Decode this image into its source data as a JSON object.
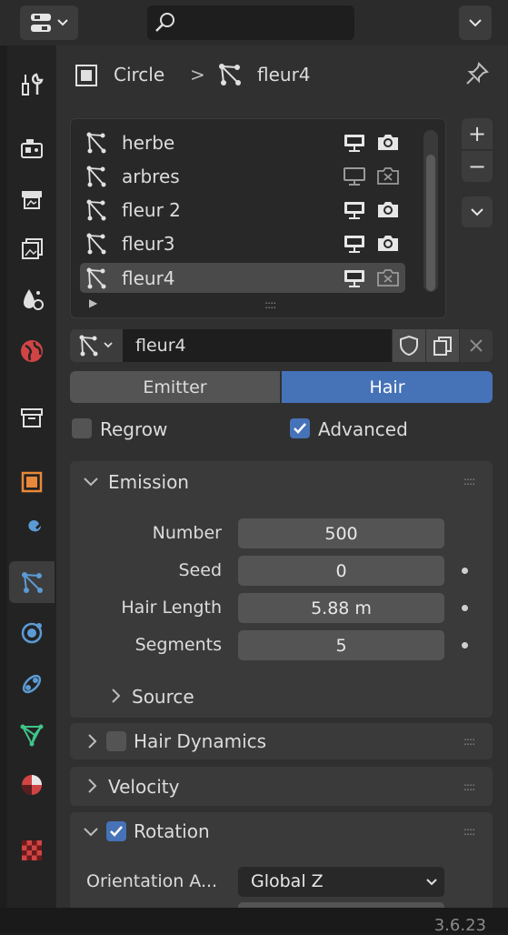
{
  "header": {
    "editor_type_icon": "properties-editor-icon",
    "search_icon": "search-icon",
    "menu_icon": "chevron-down-icon"
  },
  "tabs": [
    {
      "icon": "tool-icon"
    },
    {
      "icon": "render-icon"
    },
    {
      "icon": "output-icon"
    },
    {
      "icon": "view-layer-icon"
    },
    {
      "icon": "scene-icon"
    },
    {
      "icon": "world-icon"
    },
    {
      "icon": "collection-icon"
    },
    {
      "icon": "object-icon"
    },
    {
      "icon": "modifier-icon"
    },
    {
      "icon": "particles-icon",
      "active": true
    },
    {
      "icon": "physics-icon"
    },
    {
      "icon": "constraints-icon"
    },
    {
      "icon": "data-icon"
    },
    {
      "icon": "material-icon"
    },
    {
      "icon": "texture-icon"
    }
  ],
  "breadcrumb": {
    "object": "Circle",
    "separator": ">",
    "particle": "fleur4"
  },
  "particle_list": [
    {
      "name": "herbe",
      "viewport": true,
      "render": true
    },
    {
      "name": "arbres",
      "viewport": false,
      "render": false
    },
    {
      "name": "fleur 2",
      "viewport": true,
      "render": true
    },
    {
      "name": "fleur3",
      "viewport": true,
      "render": true
    },
    {
      "name": "fleur4",
      "viewport": true,
      "render": false,
      "active": true
    }
  ],
  "list_buttons": {
    "add": "+",
    "remove": "−"
  },
  "datablock": {
    "name": "fleur4"
  },
  "type_toggle": {
    "emitter": "Emitter",
    "hair": "Hair",
    "selected": "Hair"
  },
  "options": {
    "regrow": "Regrow",
    "regrow_checked": false,
    "advanced": "Advanced",
    "advanced_checked": true
  },
  "emission": {
    "title": "Emission",
    "number_label": "Number",
    "number": "500",
    "seed_label": "Seed",
    "seed": "0",
    "hair_length_label": "Hair Length",
    "hair_length": "5.88 m",
    "segments_label": "Segments",
    "segments": "5",
    "source_label": "Source"
  },
  "panels": {
    "hair_dynamics": "Hair Dynamics",
    "hair_dynamics_checked": false,
    "velocity": "Velocity",
    "rotation": "Rotation",
    "rotation_checked": true,
    "orientation_label": "Orientation A...",
    "orientation_value": "Global Z"
  },
  "version": "3.6.23",
  "colors": {
    "accent": "#4672b8",
    "background": "#303030",
    "field": "#545454"
  }
}
